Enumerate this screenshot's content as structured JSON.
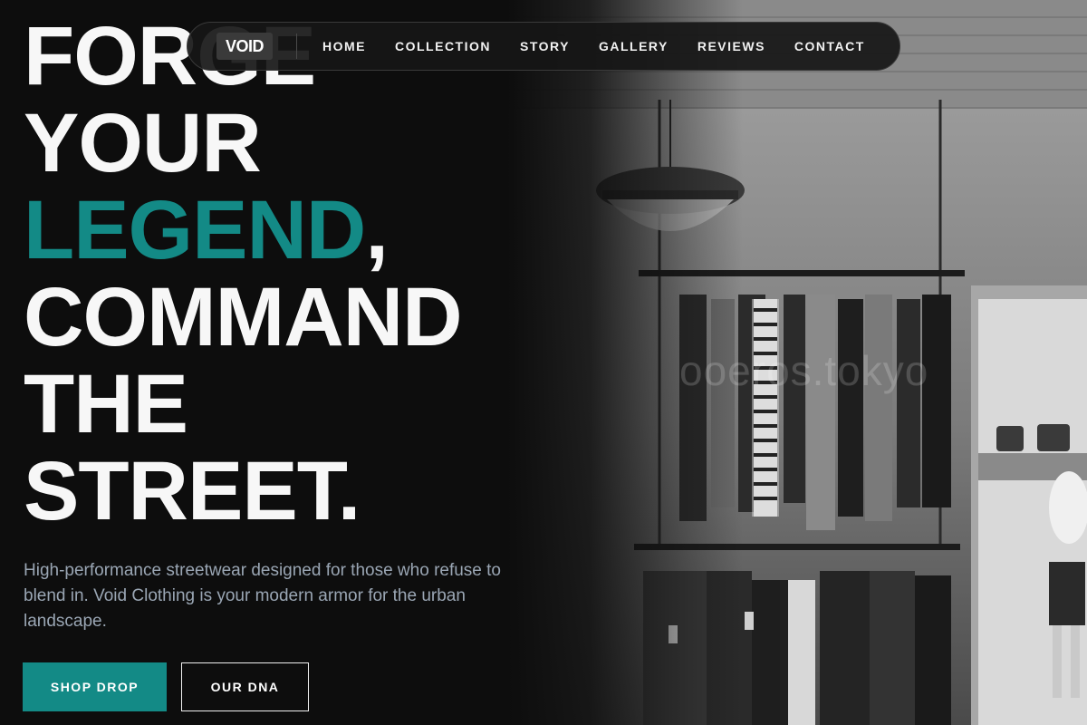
{
  "nav": {
    "logo": "VOID",
    "links": [
      "HOME",
      "COLLECTION",
      "STORY",
      "GALLERY",
      "REVIEWS",
      "CONTACT"
    ]
  },
  "hero": {
    "headline": {
      "line1": "FORGE",
      "line2": "YOUR",
      "line3_accent": "LEGEND",
      "line3_rest": ",",
      "line4": "COMMAND",
      "line5": "THE",
      "line6": "STREET."
    },
    "subtitle": "High-performance streetwear designed for those who refuse to blend in. Void Clothing is your modern armor for the urban landscape.",
    "primary_button": "SHOP DROP",
    "secondary_button": "OUR DNA"
  },
  "background": {
    "watermark": "ooeros.tokyo"
  },
  "colors": {
    "accent": "#138a86",
    "background": "#0d0d0d",
    "subtitle": "#9aa6b4"
  }
}
